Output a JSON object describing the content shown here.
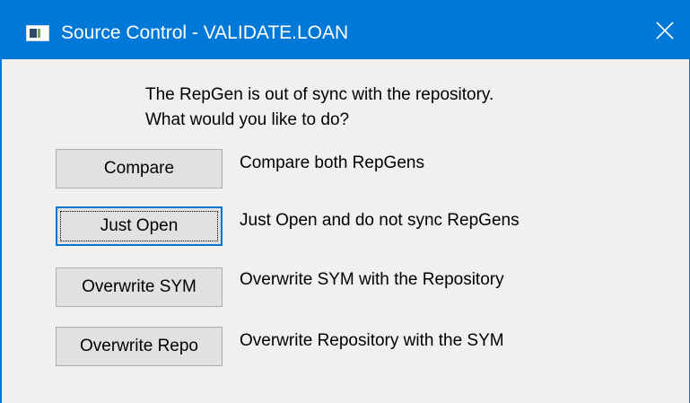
{
  "window": {
    "title": "Source Control - VALIDATE.LOAN",
    "accent_color": "#0078d7",
    "app_icon": "app-window-icon",
    "close_icon": "close-icon"
  },
  "message": {
    "line1": "The RepGen is out of sync with the repository.",
    "line2": "What would you like to do?"
  },
  "options": [
    {
      "button_label": "Compare",
      "description": "Compare both RepGens",
      "focused": false
    },
    {
      "button_label": "Just Open",
      "description": "Just Open and do not sync RepGens",
      "focused": true
    },
    {
      "button_label": "Overwrite SYM",
      "description": "Overwrite SYM with the Repository",
      "focused": false
    },
    {
      "button_label": "Overwrite Repo",
      "description": "Overwrite Repository with the SYM",
      "focused": false
    }
  ]
}
